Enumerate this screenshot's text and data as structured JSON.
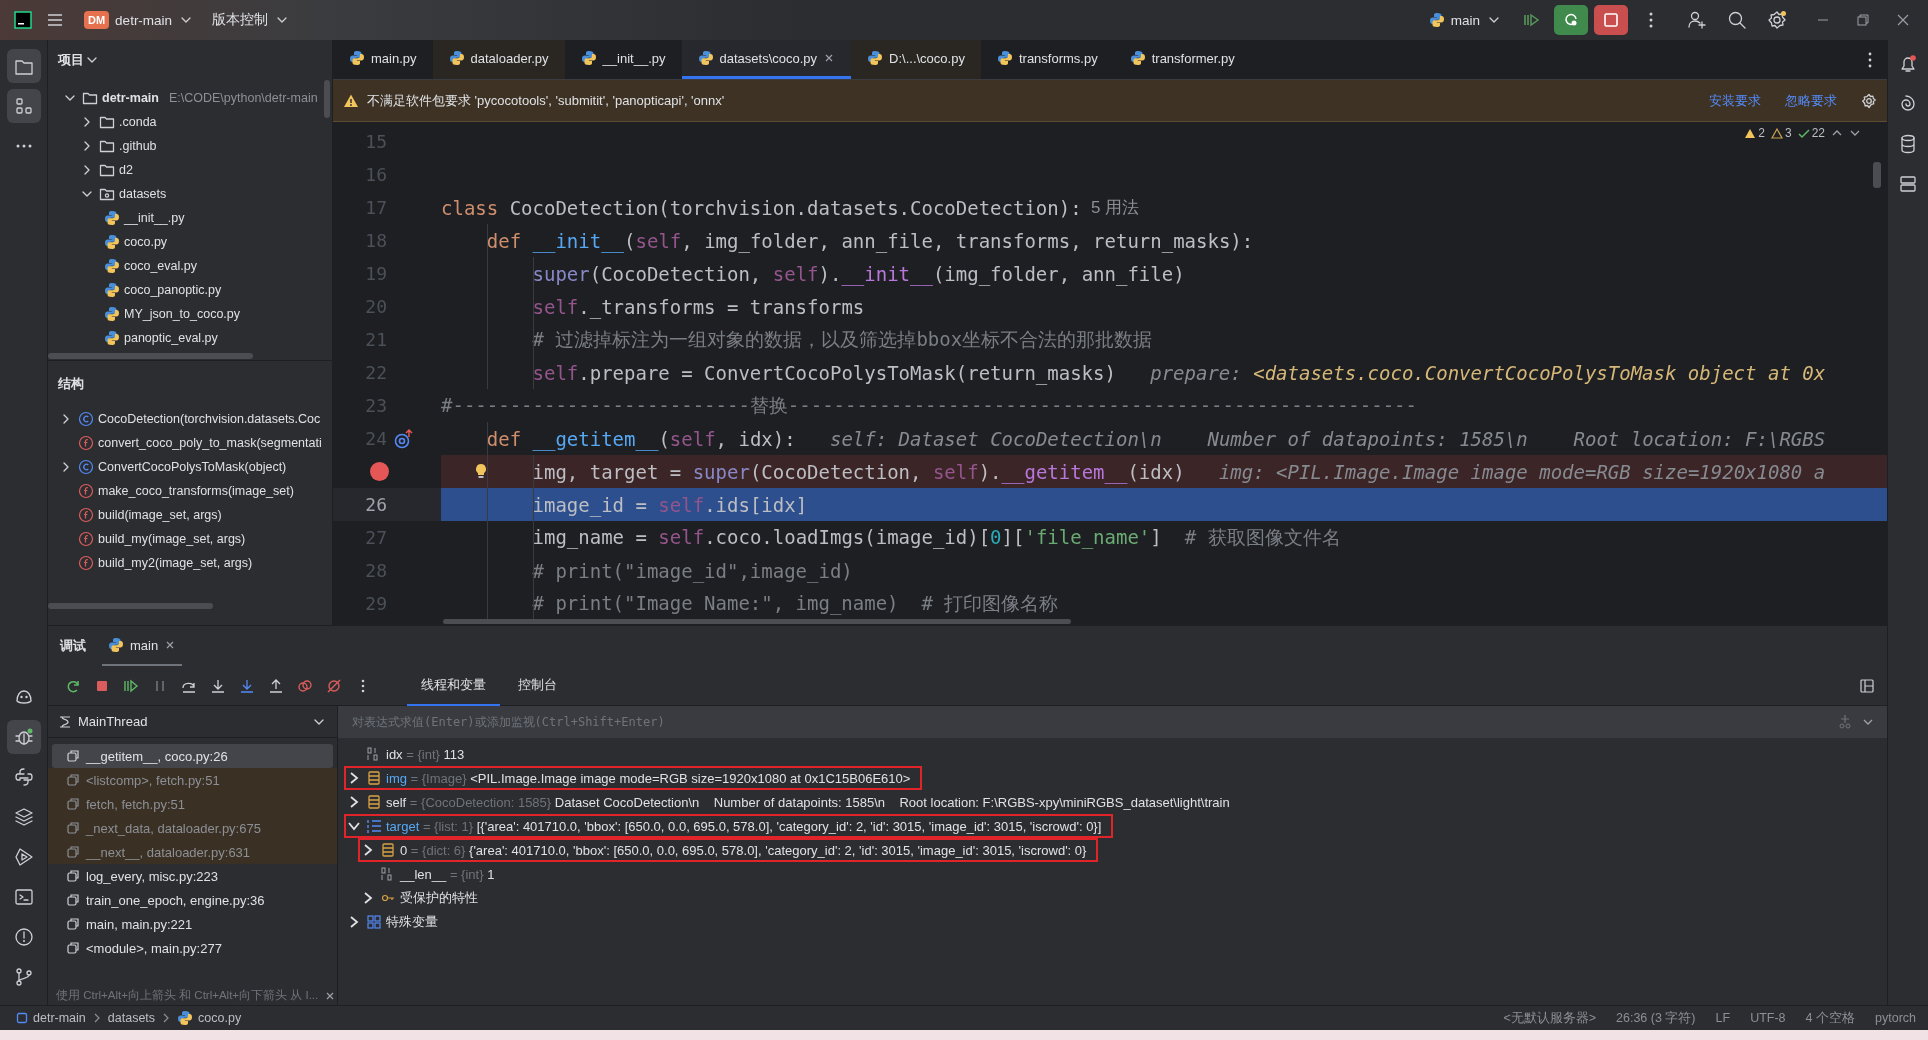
{
  "title_bar": {
    "project_badge": "DM",
    "project": "detr-main",
    "vcs": "版本控制",
    "run_config": "main"
  },
  "activity_top": [
    {
      "kind": "project",
      "selected": true
    },
    {
      "kind": "structure",
      "selected": true
    },
    {
      "kind": "more",
      "selected": false
    }
  ],
  "activity_bottom": [
    {
      "kind": "ai",
      "selected": false
    },
    {
      "kind": "debug",
      "selected": true
    },
    {
      "kind": "python",
      "selected": false
    },
    {
      "kind": "layers",
      "selected": false
    },
    {
      "kind": "run",
      "selected": false
    },
    {
      "kind": "terminal",
      "selected": false
    },
    {
      "kind": "problems",
      "selected": false
    },
    {
      "kind": "git",
      "selected": false
    }
  ],
  "project_panel": {
    "title": "项目",
    "tree": [
      {
        "kind": "folder",
        "name": "detr-main",
        "path": "E:\\CODE\\python\\detr-main",
        "expanded": true,
        "children": [
          {
            "kind": "folder",
            "name": ".conda",
            "expanded": false
          },
          {
            "kind": "folder",
            "name": ".github",
            "expanded": false
          },
          {
            "kind": "folder",
            "name": "d2",
            "expanded": false
          },
          {
            "kind": "package",
            "name": "datasets",
            "expanded": true,
            "children": [
              {
                "kind": "python",
                "name": "__init__.py"
              },
              {
                "kind": "python",
                "name": "coco.py"
              },
              {
                "kind": "python",
                "name": "coco_eval.py"
              },
              {
                "kind": "python",
                "name": "coco_panoptic.py"
              },
              {
                "kind": "python",
                "name": "MY_json_to_coco.py"
              },
              {
                "kind": "python",
                "name": "panoptic_eval.py"
              }
            ]
          }
        ]
      }
    ]
  },
  "structure_panel": {
    "title": "结构",
    "items": [
      {
        "kind": "class",
        "label": "CocoDetection(torchvision.datasets.Coc",
        "expandable": true
      },
      {
        "kind": "function",
        "label": "convert_coco_poly_to_mask(segmentati",
        "expandable": false
      },
      {
        "kind": "class",
        "label": "ConvertCocoPolysToMask(object)",
        "expandable": true
      },
      {
        "kind": "function",
        "label": "make_coco_transforms(image_set)",
        "expandable": false
      },
      {
        "kind": "function",
        "label": "build(image_set, args)",
        "expandable": false
      },
      {
        "kind": "function",
        "label": "build_my(image_set, args)",
        "expandable": false
      },
      {
        "kind": "function",
        "label": "build_my2(image_set, args)",
        "expandable": false
      }
    ]
  },
  "editor": {
    "tabs": [
      {
        "label": "main.py",
        "selected": false,
        "library": false
      },
      {
        "label": "dataloader.py",
        "selected": false,
        "library": true
      },
      {
        "label": "__init__.py",
        "selected": false,
        "library": false
      },
      {
        "label": "datasets\\coco.py",
        "selected": true,
        "library": false
      },
      {
        "label": "D:\\...\\coco.py",
        "selected": false,
        "library": true
      },
      {
        "label": "transforms.py",
        "selected": false,
        "library": false
      },
      {
        "label": "transformer.py",
        "selected": false,
        "library": false
      }
    ],
    "warning": {
      "text": "不满足软件包要求 'pycocotools', 'submitit', 'panopticapi', 'onnx'",
      "actions": [
        "安装要求",
        "忽略要求"
      ]
    },
    "inspections": [
      {
        "kind": "warning",
        "count": "2"
      },
      {
        "kind": "weak",
        "count": "3"
      },
      {
        "kind": "ok",
        "count": "22"
      }
    ],
    "lines": [
      {
        "number": "15",
        "breakpoint": false,
        "current": false,
        "override": false,
        "bulb": false
      },
      {
        "number": "16",
        "breakpoint": false,
        "current": false,
        "override": false,
        "bulb": false
      },
      {
        "number": "17",
        "breakpoint": false,
        "current": false,
        "override": false,
        "bulb": false,
        "tokens": [
          {
            "kind": "keyword",
            "text": "class"
          },
          {
            "kind": "plain",
            "text": " CocoDetection(torchvision.datasets.CocoDetection):"
          }
        ],
        "hint": [
          {
            "kind": "usage",
            "text": "5 用法"
          }
        ]
      },
      {
        "number": "18",
        "breakpoint": false,
        "current": false,
        "override": false,
        "bulb": false,
        "tokens": [
          {
            "kind": "keyword",
            "text": "    def "
          },
          {
            "kind": "function",
            "text": "__init__"
          },
          {
            "kind": "plain",
            "text": "("
          },
          {
            "kind": "self",
            "text": "self"
          },
          {
            "kind": "plain",
            "text": ", img_folder, ann_file, transforms, return_masks):"
          }
        ]
      },
      {
        "number": "19",
        "breakpoint": false,
        "current": false,
        "override": false,
        "bulb": false,
        "tokens": [
          {
            "kind": "builtin",
            "text": "        super"
          },
          {
            "kind": "plain",
            "text": "(CocoDetection, "
          },
          {
            "kind": "self",
            "text": "self"
          },
          {
            "kind": "plain",
            "text": ")."
          },
          {
            "kind": "dunder",
            "text": "__init__"
          },
          {
            "kind": "plain",
            "text": "(img_folder, ann_file)"
          }
        ]
      },
      {
        "number": "20",
        "breakpoint": false,
        "current": false,
        "override": false,
        "bulb": false,
        "tokens": [
          {
            "kind": "self",
            "text": "        self"
          },
          {
            "kind": "plain",
            "text": "._transforms = transforms"
          }
        ]
      },
      {
        "number": "21",
        "breakpoint": false,
        "current": false,
        "override": false,
        "bulb": false,
        "tokens": [
          {
            "kind": "comment",
            "text": "        # 过滤掉标注为一组对象的数据，以及筛选掉bbox坐标不合法的那批数据"
          }
        ]
      },
      {
        "number": "22",
        "breakpoint": false,
        "current": false,
        "override": false,
        "bulb": false,
        "tokens": [
          {
            "kind": "self",
            "text": "        self"
          },
          {
            "kind": "plain",
            "text": ".prepare = ConvertCocoPolysToMask(return_masks)"
          }
        ],
        "hint": [
          {
            "kind": "name",
            "text": "prepare: "
          },
          {
            "kind": "value",
            "text": "<datasets.coco.ConvertCocoPolysToMask object at 0x"
          }
        ]
      },
      {
        "number": "23",
        "breakpoint": false,
        "current": false,
        "override": false,
        "bulb": false,
        "tokens": [
          {
            "kind": "comment",
            "text": "#--------------------------替换-------------------------------------------------------"
          }
        ]
      },
      {
        "number": "24",
        "breakpoint": false,
        "current": false,
        "override": true,
        "bulb": false,
        "tokens": [
          {
            "kind": "keyword",
            "text": "    def "
          },
          {
            "kind": "function",
            "text": "__getitem__"
          },
          {
            "kind": "plain",
            "text": "("
          },
          {
            "kind": "self",
            "text": "self"
          },
          {
            "kind": "plain",
            "text": ", idx):"
          }
        ],
        "hint": [
          {
            "kind": "name",
            "text": "self: Dataset CocoDetection\\n    Number of datapoints: 1585\\n    Root location: F:\\RGBS"
          }
        ]
      },
      {
        "breakpoint": true,
        "current": false,
        "override": false,
        "bulb": true,
        "tokens": [
          {
            "kind": "plain",
            "text": "        img, target = "
          },
          {
            "kind": "builtin",
            "text": "super"
          },
          {
            "kind": "plain",
            "text": "(CocoDetection, "
          },
          {
            "kind": "self",
            "text": "self"
          },
          {
            "kind": "plain",
            "text": ")."
          },
          {
            "kind": "dunder",
            "text": "__getitem__"
          },
          {
            "kind": "plain",
            "text": "(idx)"
          }
        ],
        "hint": [
          {
            "kind": "name",
            "text": "img: <PIL.Image.Image image mode=RGB size=1920x1080 a"
          }
        ]
      },
      {
        "number": "26",
        "breakpoint": false,
        "current": true,
        "override": false,
        "bulb": false,
        "tokens": [
          {
            "kind": "plain",
            "text": "        image_id = "
          },
          {
            "kind": "self",
            "text": "self"
          },
          {
            "kind": "plain",
            "text": ".ids[idx]"
          }
        ]
      },
      {
        "number": "27",
        "breakpoint": false,
        "current": false,
        "override": false,
        "bulb": false,
        "tokens": [
          {
            "kind": "plain",
            "text": "        img_name = "
          },
          {
            "kind": "self",
            "text": "self"
          },
          {
            "kind": "plain",
            "text": ".coco.loadImgs(image_id)["
          },
          {
            "kind": "number",
            "text": "0"
          },
          {
            "kind": "plain",
            "text": "]["
          },
          {
            "kind": "string",
            "text": "'file_name'"
          },
          {
            "kind": "plain",
            "text": "]  "
          },
          {
            "kind": "comment",
            "text": "# 获取图像文件名"
          }
        ]
      },
      {
        "number": "28",
        "breakpoint": false,
        "current": false,
        "override": false,
        "bulb": false,
        "tokens": [
          {
            "kind": "comment",
            "text": "        # print(\"image_id\",image_id)"
          }
        ]
      },
      {
        "number": "29",
        "breakpoint": false,
        "current": false,
        "override": false,
        "bulb": false,
        "tokens": [
          {
            "kind": "comment",
            "text": "        # print(\"Image Name:\", img_name)  # 打印图像名称"
          }
        ]
      }
    ]
  },
  "debug": {
    "title": "调试",
    "session": "main",
    "view_tabs": [
      {
        "label": "线程和变量",
        "selected": true
      },
      {
        "label": "控制台",
        "selected": false
      }
    ],
    "thread": "MainThread",
    "frames": [
      {
        "label": "__getitem__, coco.py:26",
        "selected": true,
        "library": false
      },
      {
        "label": "<listcomp>, fetch.py:51",
        "selected": false,
        "library": true
      },
      {
        "label": "fetch, fetch.py:51",
        "selected": false,
        "library": true
      },
      {
        "label": "_next_data, dataloader.py:675",
        "selected": false,
        "library": true
      },
      {
        "label": "__next__, dataloader.py:631",
        "selected": false,
        "library": true
      },
      {
        "label": "log_every, misc.py:223",
        "selected": false,
        "library": false
      },
      {
        "label": "train_one_epoch, engine.py:36",
        "selected": false,
        "library": false
      },
      {
        "label": "main, main.py:221",
        "selected": false,
        "library": false
      },
      {
        "label": "<module>, main.py:277",
        "selected": false,
        "library": false
      }
    ],
    "frames_hint": "使用 Ctrl+Alt+向上箭头 和 Ctrl+Alt+向下箭头 从 I...",
    "eval_placeholder": "对表达式求值(Enter)或添加监视(Ctrl+Shift+Enter)",
    "variables": [
      {
        "kind": "int",
        "name": "idx",
        "type": "= {int}",
        "value": "113",
        "expandable": false,
        "changed": false,
        "boxed": false
      },
      {
        "kind": "object",
        "name": "img",
        "type": "= {Image}",
        "value": "<PIL.Image.Image image mode=RGB size=1920x1080 at 0x1C15B06E610>",
        "expandable": true,
        "expanded": false,
        "changed": true,
        "boxed": true
      },
      {
        "kind": "object",
        "name": "self",
        "type": "= {CocoDetection: 1585}",
        "value": "Dataset CocoDetection\\n    Number of datapoints: 1585\\n    Root location: F:\\RGBS-xpy\\miniRGBS_dataset\\light\\train",
        "expandable": true,
        "expanded": false,
        "changed": false,
        "boxed": false
      },
      {
        "kind": "list",
        "name": "target",
        "type": "= {list: 1}",
        "value": "[{'area': 401710.0, 'bbox': [650.0, 0.0, 695.0, 578.0], 'category_id': 2, 'id': 3015, 'image_id': 3015, 'iscrowd': 0}]",
        "expandable": true,
        "expanded": true,
        "changed": true,
        "boxed": true,
        "children": [
          {
            "kind": "object",
            "name": "0",
            "type": "= {dict: 6}",
            "value": "{'area': 401710.0, 'bbox': [650.0, 0.0, 695.0, 578.0], 'category_id': 2, 'id': 3015, 'image_id': 3015, 'iscrowd': 0}",
            "expandable": true,
            "expanded": false,
            "changed": false,
            "boxed": true
          },
          {
            "kind": "int",
            "name": "__len__",
            "type": "= {int}",
            "value": "1",
            "expandable": false,
            "changed": false,
            "boxed": false
          },
          {
            "kind": "group",
            "name": "受保护的特性",
            "expandable": true,
            "expanded": false,
            "changed": false,
            "boxed": false
          }
        ]
      },
      {
        "kind": "special",
        "name": "特殊变量",
        "expandable": true,
        "expanded": false,
        "changed": false,
        "boxed": false
      }
    ]
  },
  "status_bar": {
    "breadcrumbs": [
      {
        "kind": "module",
        "label": "detr-main"
      },
      {
        "kind": "folder",
        "label": "datasets"
      },
      {
        "kind": "python",
        "label": "coco.py"
      }
    ],
    "items": [
      "<无默认服务器>",
      "26:36 (3 字符)",
      "LF",
      "UTF-8",
      "4 个空格",
      "pytorch"
    ]
  }
}
